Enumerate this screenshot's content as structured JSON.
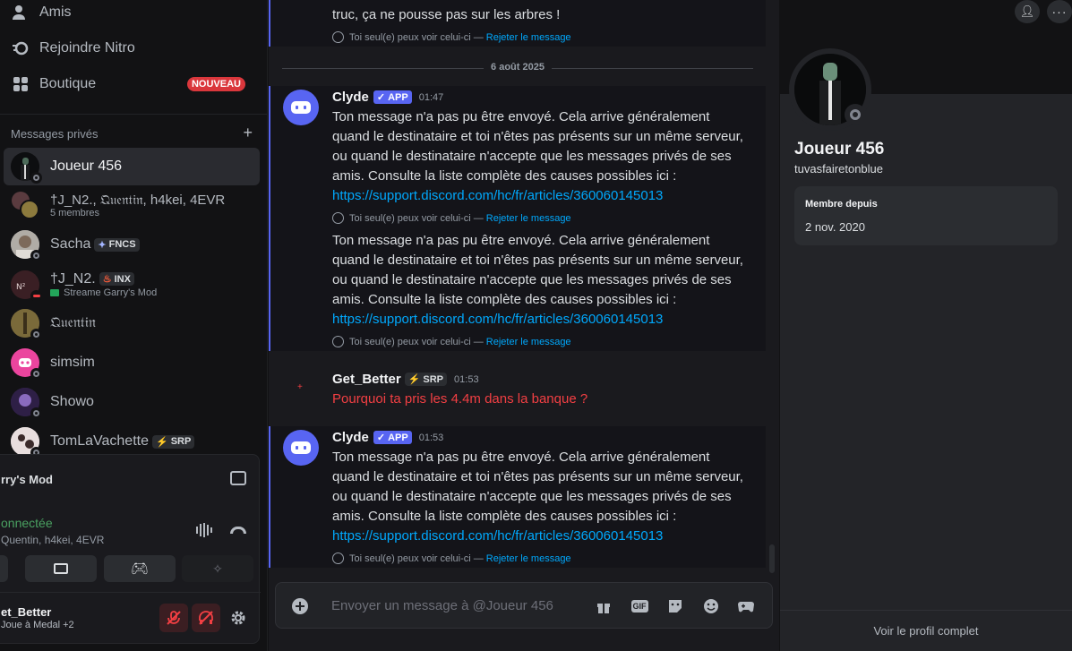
{
  "sidebar": {
    "nav": [
      {
        "label": "Amis",
        "icon": "friends-icon"
      },
      {
        "label": "Rejoindre Nitro",
        "icon": "nitro-icon"
      },
      {
        "label": "Boutique",
        "icon": "shop-icon",
        "badge": "NOUVEAU"
      }
    ],
    "dm_header": "Messages privés",
    "dms": [
      {
        "name": "Joueur 456",
        "selected": true
      },
      {
        "name": "†J_N2., 𝔔𝔲𝔢𝔫𝔱𝔦𝔫, h4kei, 4EVR",
        "sub": "5 membres"
      },
      {
        "name": "Sacha",
        "tag": "FNCS"
      },
      {
        "name": "†J_N2.",
        "tag": "INX",
        "sub": "Streame Garry's Mod"
      },
      {
        "name": "𝔔𝔲𝔢𝔫𝔱𝔦𝔫"
      },
      {
        "name": "simsim"
      },
      {
        "name": "Showo"
      },
      {
        "name": "TomLaVachette",
        "tag": "SRP"
      }
    ],
    "voice": {
      "title": "rry's Mod",
      "status": "onnectée",
      "who": "Quentin, h4kei, 4EVR"
    },
    "user": {
      "name": "et_Better",
      "activity": "Joue à Medal +2"
    }
  },
  "chat": {
    "top_text": "truc, ça ne pousse pas sur les arbres !",
    "ephemeral_note": "Toi seul(e) peux voir celui-ci —",
    "dismiss": "Rejeter le message",
    "date": "6 août 2025",
    "bot_name": "Clyde",
    "app_tag": "APP",
    "msg_text": "Ton message n'a pas pu être envoyé. Cela arrive généralement quand le destinataire et toi n'êtes pas présents sur un même serveur, ou quand le destinataire n'accepte que les messages privés de ses amis. Consulte la liste complète des causes possibles ici :",
    "link": "https://support.discord.com/hc/fr/articles/360060145013",
    "time1": "01:47",
    "time2": "01:53",
    "gb_name": "Get_Better",
    "gb_tag": "SRP",
    "gb_time": "01:53",
    "gb_text": "Pourquoi ta pris les 4.4m dans la banque ?",
    "placeholder": "Envoyer un message à @Joueur 456"
  },
  "profile": {
    "name": "Joueur 456",
    "username": "tuvasfairetonblue",
    "member_since_label": "Membre depuis",
    "member_since": "2 nov. 2020",
    "full_profile": "Voir le profil complet"
  },
  "colors": {
    "accent": "#5865f2",
    "danger": "#da373c",
    "link": "#00a8fc",
    "online_green": "#4aa161"
  }
}
